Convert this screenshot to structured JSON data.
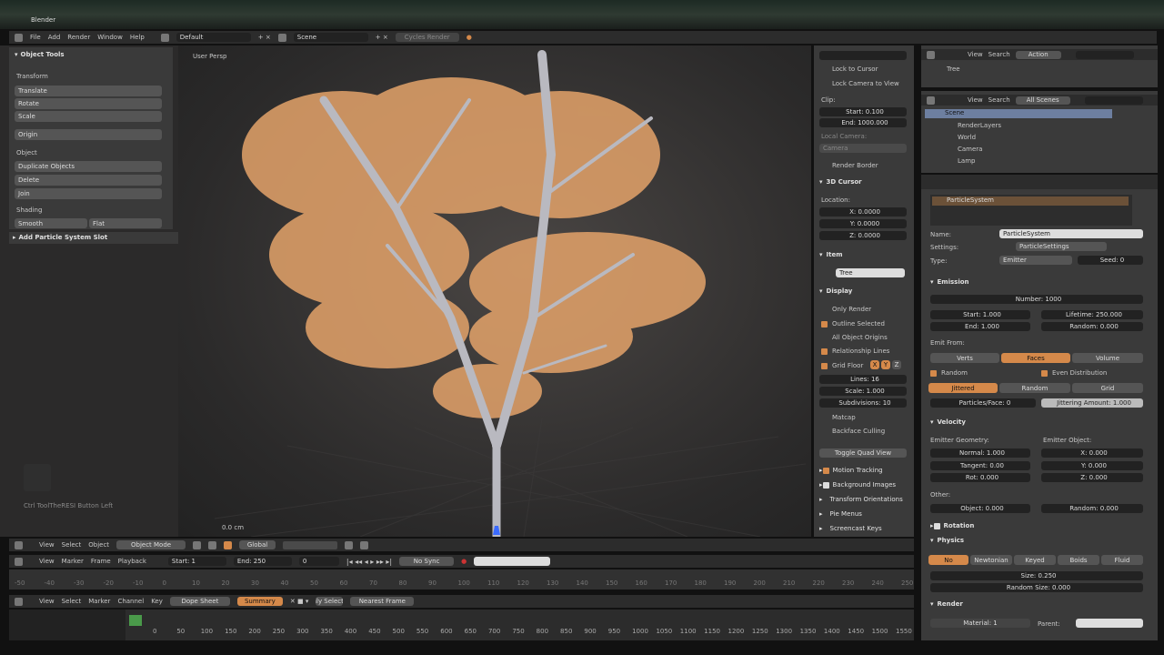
{
  "window": {
    "title": "Blender"
  },
  "menubar": {
    "items": [
      "File",
      "Add",
      "Render",
      "Window",
      "Help"
    ],
    "layout": "Default",
    "scene": "Scene",
    "engine": "Cycles Render"
  },
  "tool_shelf": {
    "title": "Object Tools",
    "transform_header": "Transform",
    "transform_items": [
      "Translate",
      "Rotate",
      "Scale"
    ],
    "origin": "Origin",
    "object_header": "Object",
    "object_items": [
      "Duplicate Objects",
      "Delete",
      "Join"
    ],
    "shading_header": "Shading",
    "smooth": "Smooth",
    "flat": "Flat",
    "operator": "Add Particle System Slot"
  },
  "viewport": {
    "label": "User Persp",
    "hint": "Ctrl ToolTheRESI Button Left",
    "units": "0.0 cm"
  },
  "properties_n": {
    "lock_cursor": "Lock to Cursor",
    "lock_camera": "Lock Camera to View",
    "clip_header": "Clip:",
    "clip_start": "Start: 0.100",
    "clip_end": "End: 1000.000",
    "local_camera": "Local Camera:",
    "camera_value": "Camera",
    "render_border": "Render Border",
    "cursor_header": "3D Cursor",
    "location_label": "Location:",
    "cursor_x": "X: 0.0000",
    "cursor_y": "Y: 0.0000",
    "cursor_z": "Z: 0.0000",
    "item_header": "Item",
    "item_name": "Tree",
    "display_header": "Display",
    "only_render": "Only Render",
    "outline_selected": "Outline Selected",
    "all_object_origins": "All Object Origins",
    "relationship_lines": "Relationship Lines",
    "grid_floor": "Grid Floor",
    "grid_axes": [
      "X",
      "Y",
      "Z"
    ],
    "lines": "Lines: 16",
    "scale": "Scale: 1.000",
    "subdivisions": "Subdivisions: 10",
    "matcap": "Matcap",
    "backface": "Backface Culling",
    "quad_view": "Toggle Quad View",
    "motion_tracking": "Motion Tracking",
    "background_images": "Background Images",
    "transform_orientations": "Transform Orientations",
    "pie_menus": "Pie Menus",
    "screencast_keys": "Screencast Keys"
  },
  "outliner": {
    "view": "View",
    "search": "Search",
    "selector": "Action",
    "top_item": "Tree",
    "view2": "View",
    "search2": "Search",
    "scenes": "All Scenes",
    "items": [
      "Scene",
      "RenderLayers",
      "World",
      "Camera",
      "Lamp"
    ]
  },
  "particles": {
    "system_name": "ParticleSystem",
    "name_label": "Name:",
    "name_value": "ParticleSystem",
    "settings_label": "Settings:",
    "settings_value": "ParticleSettings",
    "type_label": "Type:",
    "type_value": "Emitter",
    "seed": "Seed: 0",
    "emission_header": "Emission",
    "number": "Number: 1000",
    "start": "Start: 1.000",
    "end": "End: 1.000",
    "lifetime": "Lifetime: 250.000",
    "random": "Random: 0.000",
    "emit_from": "Emit From:",
    "emit_options": [
      "Verts",
      "Faces",
      "Volume"
    ],
    "random_check": "Random",
    "even_distribution": "Even Distribution",
    "dist_options": [
      "Jittered",
      "Random",
      "Grid"
    ],
    "particles_face": "Particles/Face: 0",
    "jittering": "Jittering Amount: 1.000",
    "velocity_header": "Velocity",
    "emitter_geometry": "Emitter Geometry:",
    "emitter_object": "Emitter Object:",
    "normal": "Normal: 1.000",
    "tangent": "Tangent: 0.00",
    "rot": "Rot: 0.000",
    "vx": "X: 0.000",
    "vy": "Y: 0.000",
    "vz": "Z: 0.000",
    "other": "Other:",
    "object_vel": "Object: 0.000",
    "random_vel": "Random: 0.000",
    "rotation_header": "Rotation",
    "physics_header": "Physics",
    "physics_options": [
      "No",
      "Newtonian",
      "Keyed",
      "Boids",
      "Fluid"
    ],
    "size": "Size: 0.250",
    "random_size": "Random Size: 0.000",
    "render_header": "Render",
    "material_label": "Material: 1",
    "parent_label": "Parent:"
  },
  "view3d_header": {
    "menus": [
      "View",
      "Select",
      "Object"
    ],
    "mode": "Object Mode",
    "pivot": "Global"
  },
  "timeline": {
    "menus": [
      "View",
      "Marker",
      "Frame",
      "Playback"
    ],
    "start": "Start: 1",
    "end": "End: 250",
    "current": "0",
    "sync": "No Sync",
    "ticks": [
      "-50",
      "-40",
      "-30",
      "-20",
      "-10",
      "0",
      "10",
      "20",
      "30",
      "40",
      "50",
      "60",
      "70",
      "80",
      "90",
      "100",
      "110",
      "120",
      "130",
      "140",
      "150",
      "160",
      "170",
      "180",
      "190",
      "200",
      "210",
      "220",
      "230",
      "240",
      "250"
    ]
  },
  "dopesheet": {
    "menus": [
      "View",
      "Select",
      "Marker",
      "Channel",
      "Key"
    ],
    "mode": "Dope Sheet",
    "summary": "Summary",
    "filter": "Nearest Frame",
    "only_selected": "Only Selected",
    "ticks": [
      "0",
      "50",
      "100",
      "150",
      "200",
      "250",
      "300",
      "350",
      "400",
      "450",
      "500",
      "550",
      "600",
      "650",
      "700",
      "750",
      "800",
      "850",
      "900",
      "950",
      "1000",
      "1050",
      "1100",
      "1150",
      "1200",
      "1250",
      "1300",
      "1350",
      "1400",
      "1450",
      "1500",
      "1550"
    ]
  },
  "colors": {
    "accent": "#d5894a",
    "tree": "#e9a870",
    "trunk": "#b9b9c0"
  }
}
